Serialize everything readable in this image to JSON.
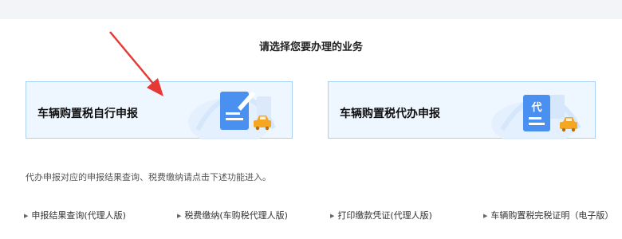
{
  "prompt": "请选择您要办理的业务",
  "cards": {
    "self": {
      "title": "车辆购置税自行申报"
    },
    "agent": {
      "title": "车辆购置税代办申报",
      "badge_char": "代"
    }
  },
  "note": "代办申报对应的申报结果查询、税费缴纳请点击下述功能进入。",
  "links": [
    "申报结果查询(代理人版)",
    "税费缴纳(车购税代理人版)",
    "打印缴款凭证(代理人版)",
    "车辆购置税完税证明（电子版）"
  ],
  "colors": {
    "card_border": "#a9d1f5",
    "card_bg": "#eef6ff",
    "doc_blue": "#4a90f0",
    "car_orange": "#f5a623",
    "annotation_arrow": "#e53935"
  }
}
